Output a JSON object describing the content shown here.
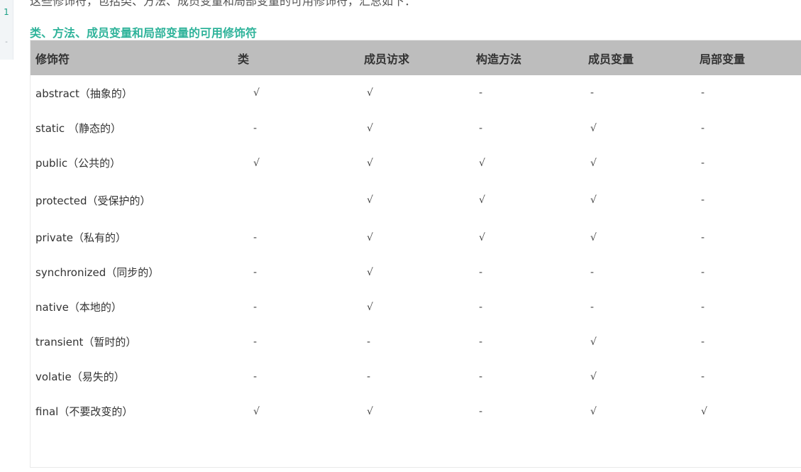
{
  "page": {
    "top_line": "这些修饰符，包括类、方法、成员变量和局部变量的可用修饰符，汇总如下：",
    "section_title": "类、方法、成员变量和局部变量的可用修饰符"
  },
  "side_widget": {
    "top_text": "1",
    "mid_text": "-"
  },
  "table": {
    "headers": [
      "修饰符",
      "类",
      "成员访求",
      "构造方法",
      "成员变量",
      "局部变量"
    ],
    "rows": [
      {
        "modifier": "abstract（抽象的）",
        "cols": [
          "√",
          "√",
          "-",
          "-",
          "-"
        ]
      },
      {
        "modifier": "static （静态的）",
        "cols": [
          "-",
          "√",
          "-",
          "√",
          "-"
        ]
      },
      {
        "modifier": "public（公共的）",
        "cols": [
          "√",
          "√",
          "√",
          "√",
          "-"
        ]
      },
      {
        "modifier": "protected（受保护的）",
        "cols": [
          "",
          "√",
          "√",
          "√",
          "-"
        ]
      },
      {
        "modifier": "private（私有的）",
        "cols": [
          "-",
          "√",
          "√",
          "√",
          "-"
        ]
      },
      {
        "modifier": "synchronized（同步的）",
        "cols": [
          "-",
          "√",
          "-",
          "-",
          "-"
        ]
      },
      {
        "modifier": "native（本地的）",
        "cols": [
          "-",
          "√",
          "-",
          "-",
          "-"
        ]
      },
      {
        "modifier": "transient（暂时的）",
        "cols": [
          "-",
          "-",
          "-",
          "√",
          "-"
        ]
      },
      {
        "modifier": "volatie（易失的）",
        "cols": [
          "-",
          "-",
          "-",
          "√",
          "-"
        ]
      },
      {
        "modifier": "final（不要改变的）",
        "cols": [
          "√",
          "√",
          "-",
          "√",
          "√"
        ]
      }
    ]
  },
  "colors": {
    "title_green": "#2fb39a",
    "header_gray": "#bdbdbd",
    "text_dark": "#333333"
  }
}
